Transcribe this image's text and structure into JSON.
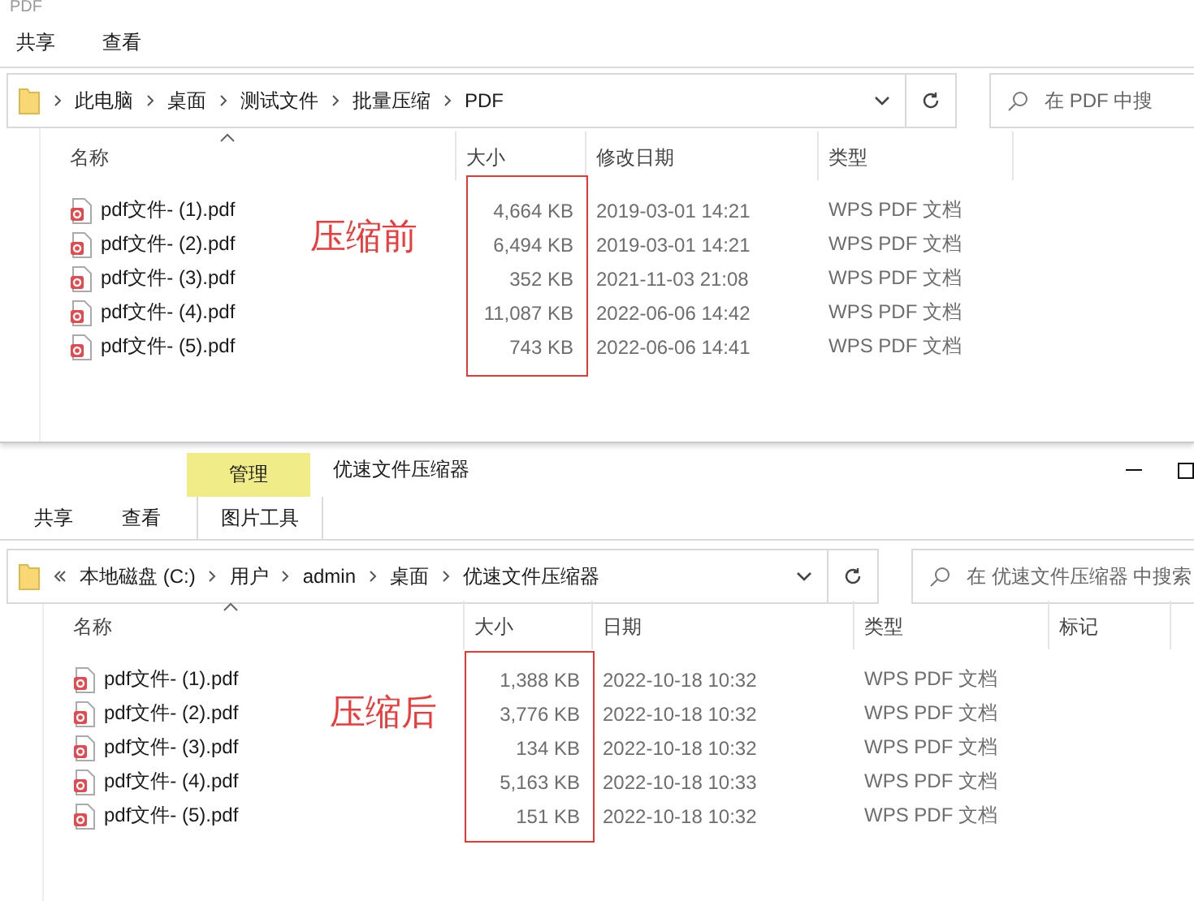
{
  "windows": [
    {
      "title": "PDF",
      "ribbon_tabs": [
        {
          "label": "共享"
        },
        {
          "label": "查看"
        }
      ],
      "address": {
        "overflow": false,
        "path": [
          "此电脑",
          "桌面",
          "测试文件",
          "批量压缩",
          "PDF"
        ]
      },
      "search": {
        "placeholder": "在 PDF 中搜"
      },
      "columns": [
        {
          "label": "名称",
          "sorted": true
        },
        {
          "label": "大小",
          "sorted": false
        },
        {
          "label": "修改日期",
          "sorted": false
        },
        {
          "label": "类型",
          "sorted": false
        }
      ],
      "rows": [
        {
          "name": "pdf文件- (1).pdf",
          "size": "4,664 KB",
          "date": "2019-03-01 14:21",
          "type": "WPS PDF 文档"
        },
        {
          "name": "pdf文件- (2).pdf",
          "size": "6,494 KB",
          "date": "2019-03-01 14:21",
          "type": "WPS PDF 文档"
        },
        {
          "name": "pdf文件- (3).pdf",
          "size": "352 KB",
          "date": "2021-11-03 21:08",
          "type": "WPS PDF 文档"
        },
        {
          "name": "pdf文件- (4).pdf",
          "size": "11,087 KB",
          "date": "2022-06-06 14:42",
          "type": "WPS PDF 文档"
        },
        {
          "name": "pdf文件- (5).pdf",
          "size": "743 KB",
          "date": "2022-06-06 14:41",
          "type": "WPS PDF 文档"
        }
      ],
      "annotation": "压缩前"
    },
    {
      "title": "优速文件压缩器",
      "context_tab": {
        "label": "管理",
        "tool": "图片工具"
      },
      "ribbon_tabs": [
        {
          "label": "共享"
        },
        {
          "label": "查看"
        }
      ],
      "address": {
        "overflow": true,
        "path": [
          "本地磁盘 (C:)",
          "用户",
          "admin",
          "桌面",
          "优速文件压缩器"
        ]
      },
      "search": {
        "placeholder": "在 优速文件压缩器 中搜索"
      },
      "columns": [
        {
          "label": "名称",
          "sorted": true
        },
        {
          "label": "大小",
          "sorted": false
        },
        {
          "label": "日期",
          "sorted": false
        },
        {
          "label": "类型",
          "sorted": false
        },
        {
          "label": "标记",
          "sorted": false
        }
      ],
      "rows": [
        {
          "name": "pdf文件- (1).pdf",
          "size": "1,388 KB",
          "date": "2022-10-18 10:32",
          "type": "WPS PDF 文档"
        },
        {
          "name": "pdf文件- (2).pdf",
          "size": "3,776 KB",
          "date": "2022-10-18 10:32",
          "type": "WPS PDF 文档"
        },
        {
          "name": "pdf文件- (3).pdf",
          "size": "134 KB",
          "date": "2022-10-18 10:32",
          "type": "WPS PDF 文档"
        },
        {
          "name": "pdf文件- (4).pdf",
          "size": "5,163 KB",
          "date": "2022-10-18 10:33",
          "type": "WPS PDF 文档"
        },
        {
          "name": "pdf文件- (5).pdf",
          "size": "151 KB",
          "date": "2022-10-18 10:32",
          "type": "WPS PDF 文档"
        }
      ],
      "annotation": "压缩后"
    }
  ]
}
